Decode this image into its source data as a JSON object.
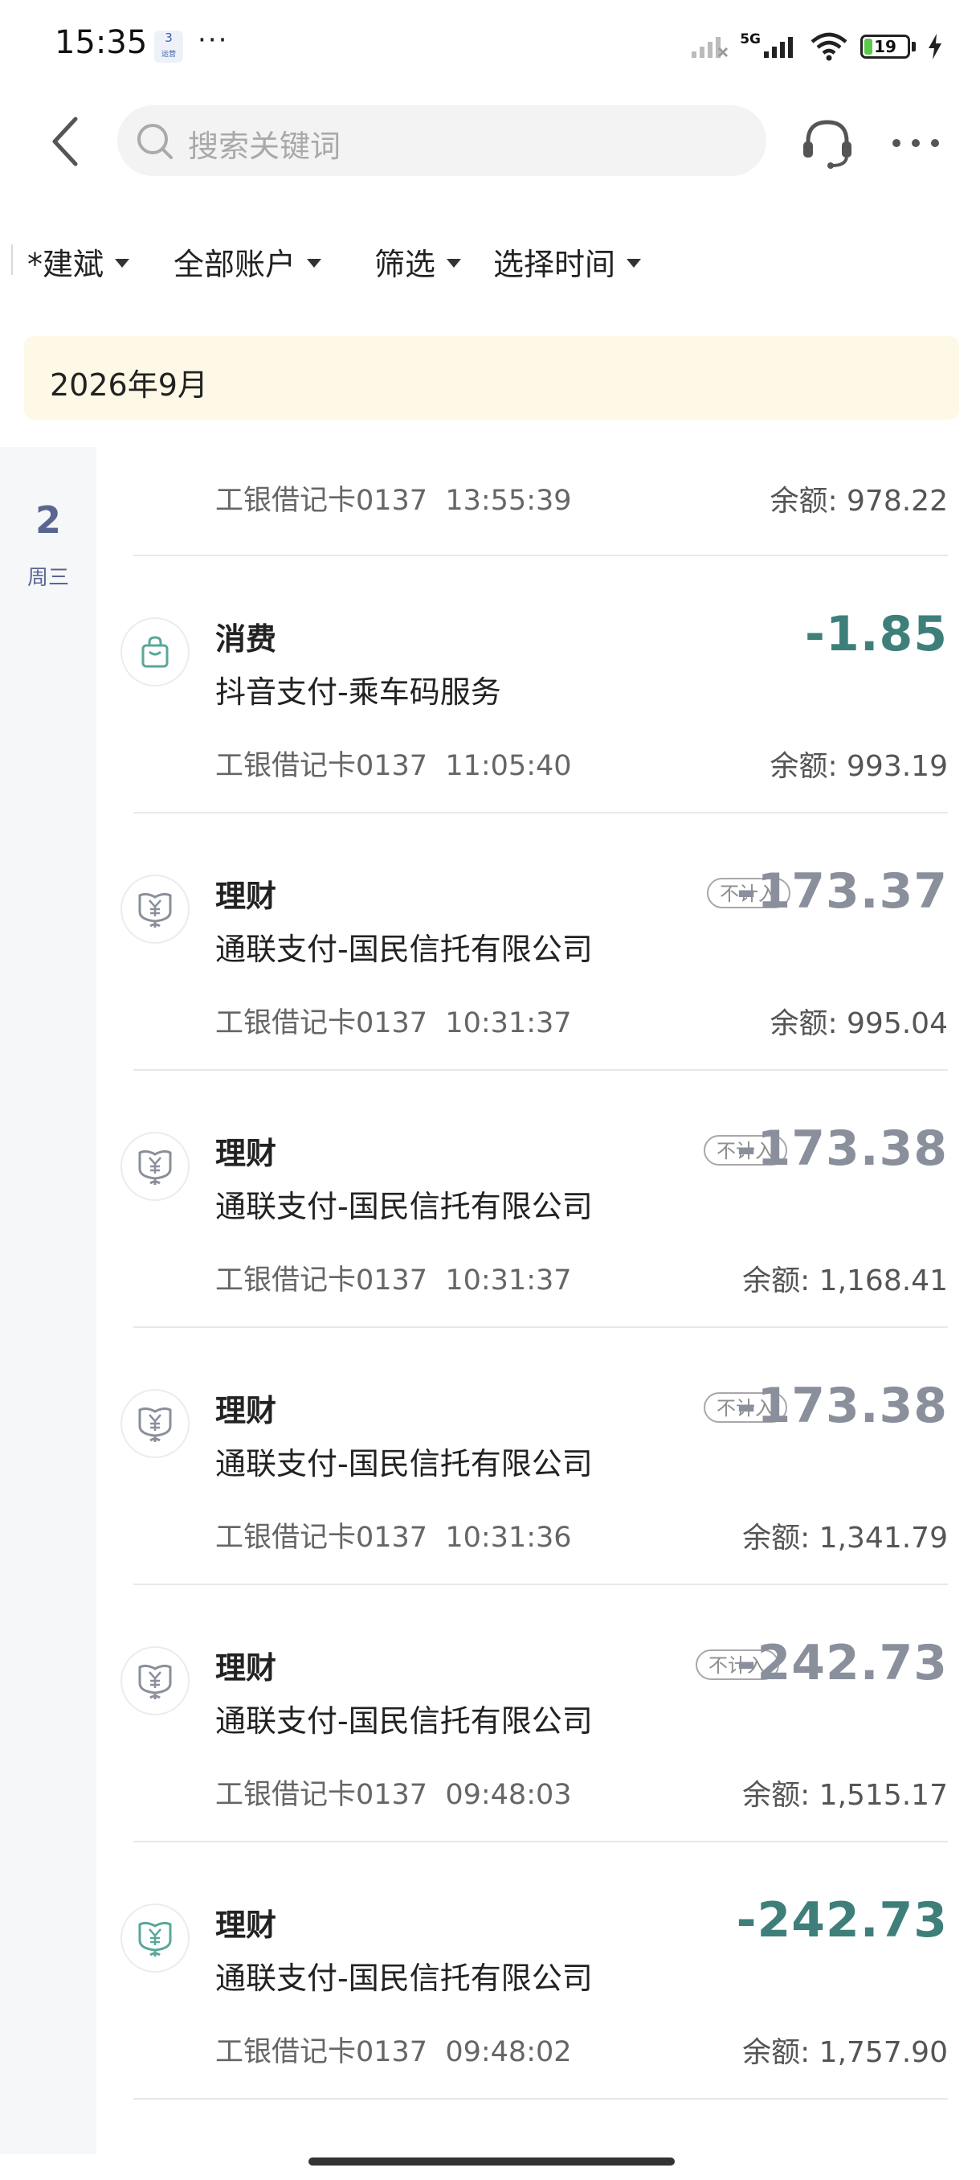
{
  "status_bar": {
    "time": "15:35",
    "notification_badge": "3",
    "notification_sub": "运营",
    "dots": "···",
    "network": "5G",
    "battery": "19",
    "battery_level": 0.19
  },
  "header": {
    "search_placeholder": "搜索关键词",
    "icons": {
      "back": "chevron-left-icon",
      "search": "search-icon",
      "service": "headset-icon",
      "more": "more-icon"
    }
  },
  "filters": [
    {
      "label": "*建斌"
    },
    {
      "label": "全部账户"
    },
    {
      "label": "筛选"
    },
    {
      "label": "选择时间"
    }
  ],
  "month": "2026年9月",
  "day": {
    "num": "2",
    "week": "周三"
  },
  "first_row": {
    "meta": "工银借记卡0137  13:55:39",
    "balance": "余额: 978.22"
  },
  "colors": {
    "teal": "#3e7f7a",
    "gray": "#8a8f9c",
    "banner": "#fdf9e6"
  },
  "transactions": [
    {
      "category": "消费",
      "merchant": "抖音支付-乘车码服务",
      "meta": "工银借记卡0137  11:05:40",
      "amount": "-1.85",
      "amount_color": "teal",
      "badge": "",
      "balance": "余额: 993.19",
      "icon": "shopping-bag-icon"
    },
    {
      "category": "理财",
      "merchant": "通联支付-国民信托有限公司",
      "meta": "工银借记卡0137  10:31:37",
      "amount": "-173.37",
      "amount_color": "gray",
      "badge": "不计入",
      "balance": "余额: 995.04",
      "icon": "wealth-icon"
    },
    {
      "category": "理财",
      "merchant": "通联支付-国民信托有限公司",
      "meta": "工银借记卡0137  10:31:37",
      "amount": "-173.38",
      "amount_color": "gray",
      "badge": "不计入",
      "balance": "余额: 1,168.41",
      "icon": "wealth-icon"
    },
    {
      "category": "理财",
      "merchant": "通联支付-国民信托有限公司",
      "meta": "工银借记卡0137  10:31:36",
      "amount": "-173.38",
      "amount_color": "gray",
      "badge": "不计入",
      "balance": "余额: 1,341.79",
      "icon": "wealth-icon"
    },
    {
      "category": "理财",
      "merchant": "通联支付-国民信托有限公司",
      "meta": "工银借记卡0137  09:48:03",
      "amount": "-242.73",
      "amount_color": "gray",
      "badge": "不计入",
      "balance": "余额: 1,515.17",
      "icon": "wealth-icon"
    },
    {
      "category": "理财",
      "merchant": "通联支付-国民信托有限公司",
      "meta": "工银借记卡0137  09:48:02",
      "amount": "-242.73",
      "amount_color": "teal",
      "badge": "",
      "balance": "余额: 1,757.90",
      "icon": "wealth-icon"
    }
  ]
}
